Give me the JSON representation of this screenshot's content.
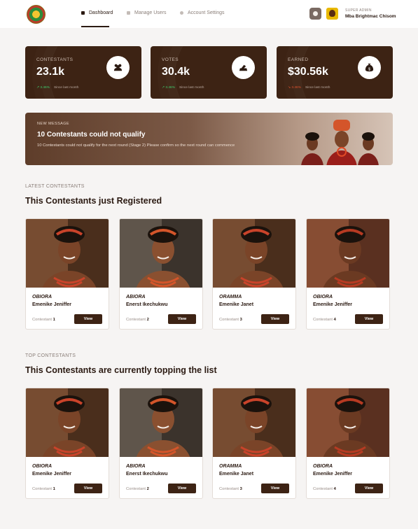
{
  "header": {
    "nav": [
      {
        "label": "Dashboard"
      },
      {
        "label": "Manage Users"
      },
      {
        "label": "Account Settings"
      }
    ],
    "user": {
      "role": "SUPER ADMIN",
      "name": "Mba Brightmac Chisom"
    }
  },
  "stats": [
    {
      "label": "CONTESTANTS",
      "value": "23.1k",
      "trend": "↗ 3.46%",
      "trend_dir": "up",
      "since": "Since last month",
      "icon": "group-icon"
    },
    {
      "label": "VOTES",
      "value": "30.4k",
      "trend": "↗ 3.46%",
      "trend_dir": "up",
      "since": "Since last month",
      "icon": "ballot-icon"
    },
    {
      "label": "EARNED",
      "value": "$30.56k",
      "trend": "↘ 3.46%",
      "trend_dir": "down",
      "since": "Since last month",
      "icon": "money-bag-icon"
    }
  ],
  "message": {
    "tag": "NEW MESSAGE",
    "title": "10 Contestants could not qualify",
    "text": "10 Contestants could not qualify for the next round (Stage 2) Please confirm so the next round can commence"
  },
  "latest": {
    "tag": "LATEST CONTESTANTS",
    "title": "This Contestants just Registered",
    "cards": [
      {
        "stage": "OBIORA",
        "name": "Emenike Jeniffer",
        "num_label": "Contestant",
        "num": "1",
        "button": "View"
      },
      {
        "stage": "ABIORA",
        "name": "Enerst Ikechukwu",
        "num_label": "Contestant",
        "num": "2",
        "button": "View"
      },
      {
        "stage": "ORAMMA",
        "name": "Emenike Janet",
        "num_label": "Contestant",
        "num": "3",
        "button": "View"
      },
      {
        "stage": "OBIORA",
        "name": "Emenike Jeniffer",
        "num_label": "Contestant",
        "num": "4",
        "button": "View"
      }
    ]
  },
  "top": {
    "tag": "TOP CONTESTANTS",
    "title": "This Contestants are currently topping the list",
    "cards": [
      {
        "stage": "OBIORA",
        "name": "Emenike Jeniffer",
        "num_label": "Contestant",
        "num": "1",
        "button": "View"
      },
      {
        "stage": "ABIORA",
        "name": "Enerst Ikechukwu",
        "num_label": "Contestant",
        "num": "2",
        "button": "View"
      },
      {
        "stage": "ORAMMA",
        "name": "Emenike Janet",
        "num_label": "Contestant",
        "num": "3",
        "button": "View"
      },
      {
        "stage": "OBIORA",
        "name": "Emenike Jeniffer",
        "num_label": "Contestant",
        "num": "4",
        "button": "View"
      }
    ]
  },
  "colors": {
    "primary": "#3d2314",
    "up": "#3fcf6e",
    "down": "#e0532f",
    "background": "#f6f4f3"
  }
}
